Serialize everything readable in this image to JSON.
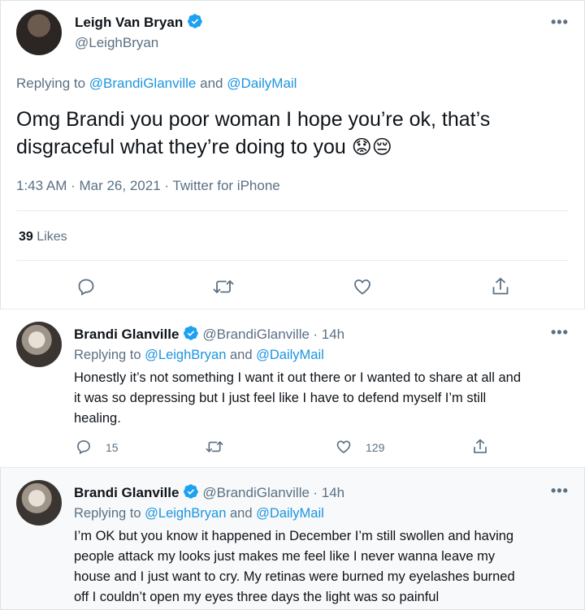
{
  "main_tweet": {
    "display_name": "Leigh Van Bryan",
    "handle": "@LeighBryan",
    "replying_prefix": "Replying to",
    "reply_to_1": "@BrandiGlanville",
    "reply_and": "and",
    "reply_to_2": "@DailyMail",
    "text_line1": "Omg Brandi you poor woman I hope you’re ok, that’s",
    "text_line2": "disgraceful what they’re doing to you",
    "emoji_1": "😟",
    "emoji_2": "😔",
    "timestamp": "1:43 AM · Mar 26, 2021 · Twitter for iPhone",
    "likes_count": "39",
    "likes_label": "Likes",
    "more": "•••"
  },
  "replies": [
    {
      "display_name": "Brandi Glanville",
      "handle": "@BrandiGlanville",
      "time": "· 14h",
      "replying_prefix": "Replying to",
      "reply_to_1": "@LeighBryan",
      "reply_and": "and",
      "reply_to_2": "@DailyMail",
      "lines": [
        "Honestly it’s not something I want it out there or I wanted to share at all and",
        "it was so depressing but I just feel like I have to defend myself I’m still",
        "healing."
      ],
      "reply_count": "15",
      "retweet_count": "",
      "like_count": "129",
      "more": "•••"
    },
    {
      "display_name": "Brandi Glanville",
      "handle": "@BrandiGlanville",
      "time": "· 14h",
      "replying_prefix": "Replying to",
      "reply_to_1": "@LeighBryan",
      "reply_and": "and",
      "reply_to_2": "@DailyMail",
      "lines": [
        "I’m OK but you know it happened in December I’m still swollen and having",
        "people attack my looks  just makes me feel like I never wanna leave my",
        "house and I just want to cry. My retinas were burned my eyelashes burned",
        "off I couldn’t open my eyes three days the light was so painful"
      ],
      "more": "•••"
    }
  ],
  "colors": {
    "link": "#1b95e0",
    "muted": "#5b7083",
    "divider": "#e6ecf0",
    "reply_bg": "#f7f9fa"
  },
  "icons": [
    "verified-badge-icon",
    "more-icon",
    "reply-icon",
    "retweet-icon",
    "like-icon",
    "share-icon"
  ]
}
